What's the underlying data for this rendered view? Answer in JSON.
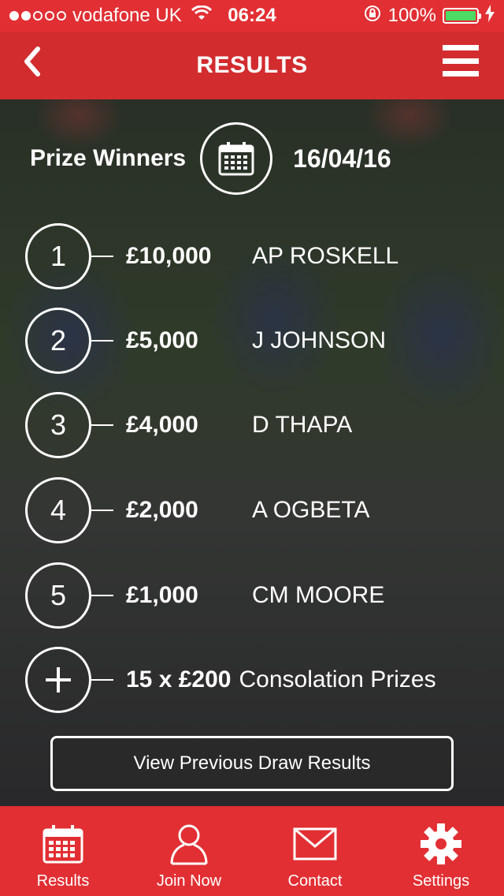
{
  "status_bar": {
    "carrier": "vodafone UK",
    "time": "06:24",
    "battery": "100%",
    "signal_bars_on": 2,
    "signal_bars_total": 5,
    "battery_color": "#4cd964"
  },
  "header": {
    "title": "RESULTS",
    "back_icon": "chevron-left-icon",
    "menu_icon": "hamburger-menu-icon"
  },
  "winners": {
    "label": "Prize Winners",
    "date": "16/04/16",
    "calendar_icon": "calendar-icon"
  },
  "prizes": [
    {
      "position": "1",
      "amount": "£10,000",
      "name": "AP ROSKELL"
    },
    {
      "position": "2",
      "amount": "£5,000",
      "name": "J JOHNSON"
    },
    {
      "position": "3",
      "amount": "£4,000",
      "name": "D THAPA"
    },
    {
      "position": "4",
      "amount": "£2,000",
      "name": "A OGBETA"
    },
    {
      "position": "5",
      "amount": "£1,000",
      "name": "CM MOORE"
    }
  ],
  "consolation": {
    "icon": "plus-icon",
    "amount": "15 x £200",
    "label": "Consolation Prizes"
  },
  "previous_button": "View Previous Draw Results",
  "tabs": [
    {
      "label": "Results",
      "icon": "calendar-icon"
    },
    {
      "label": "Join Now",
      "icon": "person-icon"
    },
    {
      "label": "Contact",
      "icon": "envelope-icon"
    },
    {
      "label": "Settings",
      "icon": "gear-icon"
    }
  ],
  "colors": {
    "brand_red": "#e22f33",
    "text": "#ffffff"
  }
}
